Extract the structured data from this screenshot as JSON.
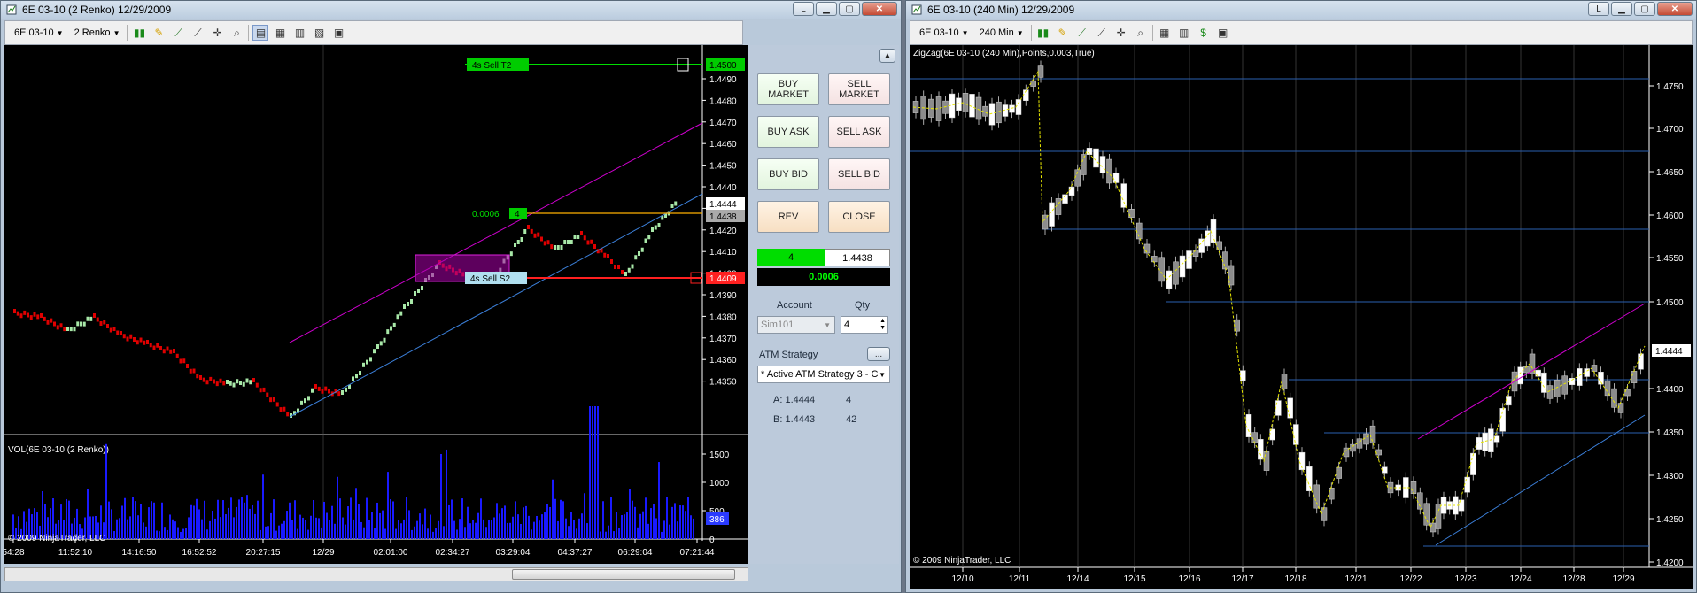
{
  "window1": {
    "title": "6E 03-10 (2 Renko)  12/29/2009",
    "toolbar": {
      "instrument": "6E 03-10",
      "period": "2 Renko"
    },
    "title_buttons": {
      "l": "L"
    },
    "chart": {
      "price_axis": [
        "1.4490",
        "1.4480",
        "1.4470",
        "1.4460",
        "1.4450",
        "1.4440",
        "1.4430",
        "1.4420",
        "1.4410",
        "1.4400",
        "1.4390",
        "1.4380",
        "1.4370",
        "1.4360",
        "1.4350"
      ],
      "price_boxes": {
        "sell_t2": "1.4500",
        "last": "1.4444",
        "entry": "1.4438",
        "sell_s2": "1.4409"
      },
      "order_labels": {
        "sell_t2": "4s   Sell T2",
        "sell_s2": "4s   Sell S2",
        "pnl": "0.0006",
        "qty": "4"
      },
      "vol_title": "VOL(6E 03-10 (2 Renko))",
      "vol_axis": [
        "1500",
        "1000",
        "500",
        "0"
      ],
      "vol_last": "386",
      "copyright": "© 2009 NinjaTrader, LLC",
      "time_axis": [
        "54:28",
        "11:52:10",
        "14:16:50",
        "16:52:52",
        "20:27:15",
        "12/29",
        "02:01:00",
        "02:34:27",
        "03:29:04",
        "04:37:27",
        "06:29:04",
        "07:21:44"
      ]
    },
    "order_panel": {
      "buy_market": "BUY MARKET",
      "sell_market": "SELL MARKET",
      "buy_ask": "BUY ASK",
      "sell_ask": "SELL ASK",
      "buy_bid": "BUY BID",
      "sell_bid": "SELL BID",
      "rev": "REV",
      "close": "CLOSE",
      "position_qty": "4",
      "position_price": "1.4438",
      "pnl": "0.0006",
      "account_label": "Account",
      "qty_label": "Qty",
      "account_value": "Sim101",
      "qty_value": "4",
      "atm_label": "ATM Strategy",
      "atm_more": "...",
      "atm_value": "* Active ATM Strategy 3 - C",
      "ask_label": "A: 1.4444",
      "ask_size": "4",
      "bid_label": "B: 1.4443",
      "bid_size": "42"
    }
  },
  "window2": {
    "title": "6E 03-10 (240 Min)  12/29/2009",
    "toolbar": {
      "instrument": "6E 03-10",
      "period": "240 Min"
    },
    "title_buttons": {
      "l": "L"
    },
    "chart": {
      "indicator_label": "ZigZag(6E 03-10 (240 Min),Points,0.003,True)",
      "price_axis": [
        "1.4750",
        "1.4700",
        "1.4650",
        "1.4600",
        "1.4550",
        "1.4500",
        "1.4400",
        "1.4350",
        "1.4300",
        "1.4250",
        "1.4200"
      ],
      "last_price": "1.4444",
      "copyright": "© 2009 NinjaTrader, LLC",
      "date_axis": [
        "12/10",
        "12/11",
        "12/14",
        "12/15",
        "12/16",
        "12/17",
        "12/18",
        "12/21",
        "12/22",
        "12/23",
        "12/24",
        "12/28",
        "12/29"
      ]
    }
  },
  "colors": {
    "up_renko": "#a8e8a8",
    "down_renko": "#e00000",
    "volume": "#1a1aff",
    "channel_upper": "#cc00cc",
    "channel_lower": "#3b7fd9",
    "zigzag": "#e6e600",
    "hline": "#2a5fb0",
    "sell_t2": "#00dd00",
    "sell_s2": "#ff2020",
    "entry": "#ffb000"
  }
}
